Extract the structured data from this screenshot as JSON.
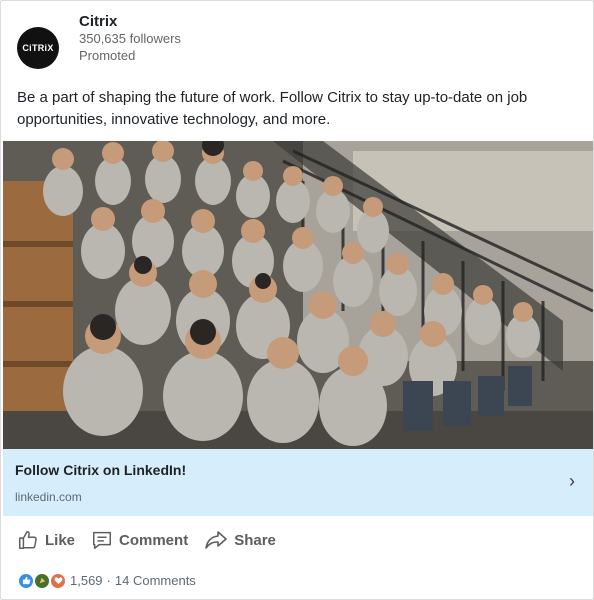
{
  "company": {
    "logo_text": "CiTRiX",
    "name": "Citrix",
    "followers": "350,635 followers",
    "promoted": "Promoted"
  },
  "post": {
    "text": "Be a part of shaping the future of work. Follow Citrix to stay up-to-date on job opportunities, innovative technology, and more."
  },
  "link": {
    "title": "Follow Citrix on LinkedIn!",
    "url": "linkedin.com"
  },
  "actions": {
    "like": "Like",
    "comment": "Comment",
    "share": "Share"
  },
  "social": {
    "reaction_count": "1,569",
    "comments": "14 Comments"
  },
  "colors": {
    "link_bar": "#d6edfb",
    "like_blue": "#378fe9",
    "celebrate_green": "#44712e",
    "love_red": "#df704d"
  }
}
